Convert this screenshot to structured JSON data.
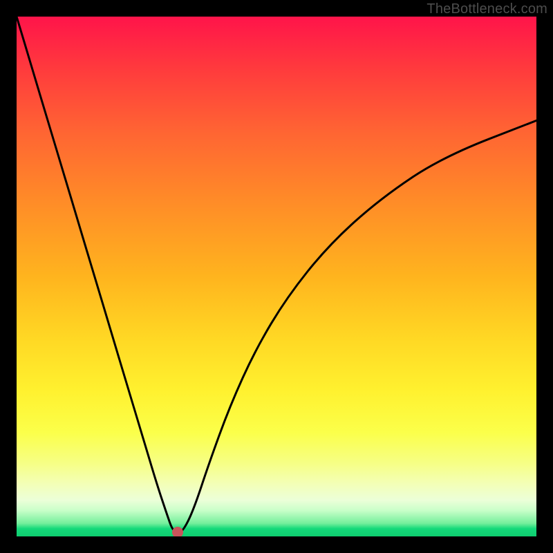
{
  "watermark": {
    "text": "TheBottleneck.com"
  },
  "chart_data": {
    "type": "line",
    "title": "",
    "xlabel": "",
    "ylabel": "",
    "xlim": [
      0,
      100
    ],
    "ylim": [
      0,
      100
    ],
    "grid": false,
    "legend": false,
    "note": "V-shaped bottleneck curve: steep linear drop from top-left to a minimum near x≈31, then a concave rise toward the right edge reaching ~80%.",
    "series": [
      {
        "name": "bottleneck-curve",
        "x": [
          0,
          3,
          6,
          9,
          12,
          15,
          18,
          21,
          24,
          27,
          29,
          30,
          31,
          32,
          34,
          37,
          41,
          46,
          52,
          60,
          70,
          82,
          100
        ],
        "y": [
          100,
          90,
          80,
          70,
          60,
          50,
          40,
          30,
          20,
          10,
          4,
          1.2,
          0.8,
          1.0,
          5,
          14,
          25,
          36,
          46,
          56,
          65,
          73,
          80
        ]
      }
    ],
    "marker": {
      "x": 31,
      "y": 0.8,
      "color": "#c9545b"
    },
    "gradient_stops": [
      {
        "pos": 0.0,
        "color": "#ff144a"
      },
      {
        "pos": 0.1,
        "color": "#ff3a3d"
      },
      {
        "pos": 0.22,
        "color": "#ff6433"
      },
      {
        "pos": 0.35,
        "color": "#ff8a28"
      },
      {
        "pos": 0.5,
        "color": "#ffb41e"
      },
      {
        "pos": 0.62,
        "color": "#ffd824"
      },
      {
        "pos": 0.72,
        "color": "#fff12f"
      },
      {
        "pos": 0.8,
        "color": "#fbff4a"
      },
      {
        "pos": 0.86,
        "color": "#f6ff86"
      },
      {
        "pos": 0.9,
        "color": "#f3ffb8"
      },
      {
        "pos": 0.93,
        "color": "#ecffd8"
      },
      {
        "pos": 0.95,
        "color": "#c9ffc9"
      },
      {
        "pos": 0.975,
        "color": "#74ef9b"
      },
      {
        "pos": 0.985,
        "color": "#14d97a"
      },
      {
        "pos": 1.0,
        "color": "#0fce70"
      }
    ]
  }
}
